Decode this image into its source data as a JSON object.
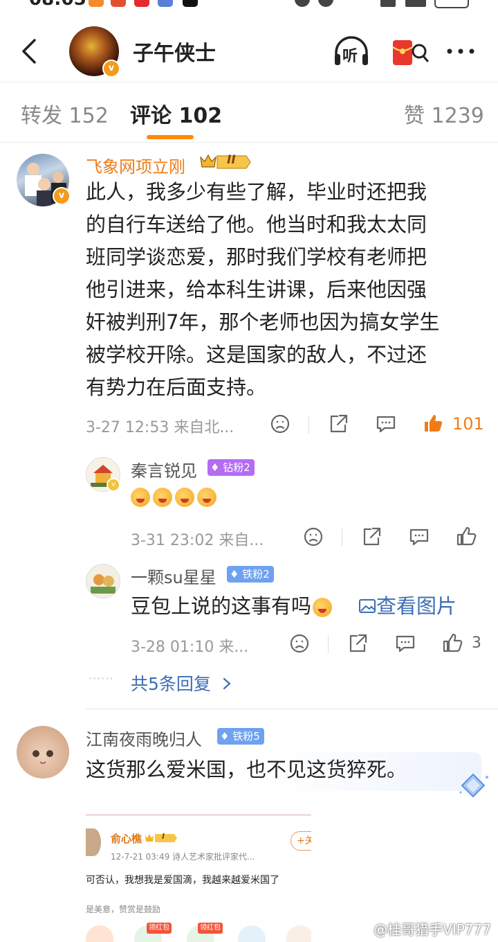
{
  "status_bar": {
    "time": "08:05"
  },
  "header": {
    "title": "子午侠士",
    "listen_label": "听"
  },
  "tabs": [
    {
      "label": "转发 152"
    },
    {
      "label": "评论 102"
    },
    {
      "label": "赞 1239"
    }
  ],
  "comments": [
    {
      "user": "飞象网项立刚",
      "level_badge": "II",
      "text": "此人，我多少有些了解，毕业时还把我的自行车送给了他。他当时和我太太同班同学谈恋爱，那时我们学校有老师把他引进来，给本科生讲课，后来他因强奸被判刑7年，那个老师也因为搞女学生被学校开除。这是国家的敌人，不过还有势力在后面支持。",
      "lines": [
        "此人，我多少有些了解，毕业时还把我",
        "的自行车送给了他。他当时和我太太同",
        "班同学谈恋爱，那时我们学校有老师把",
        "他引进来，给本科生讲课，后来他因强",
        "奸被判刑7年，那个老师也因为搞女学生",
        "被学校开除。这是国家的敌人，不过还",
        "有势力在后面支持。"
      ],
      "meta": "3-27 12:53  来自北...",
      "likes": "101",
      "replies": [
        {
          "user": "秦言锐见",
          "badge": "钻粉2",
          "meta": "3-31 23:02  来自...",
          "likes": ""
        },
        {
          "user": "一颗su星星",
          "badge": "铁粉2",
          "text": "豆包上说的这事有吗",
          "view_image": "查看图片",
          "meta": "3-28 01:10  来...",
          "likes": "3"
        }
      ],
      "more_replies": "共5条回复",
      "more_dots": "······"
    },
    {
      "user": "江南夜雨晚归人",
      "badge": "铁粉5",
      "text": "这货那么爱米国，也不见这货猝死。"
    }
  ],
  "embedded_screenshot": {
    "user": "俞心樵",
    "badge": "I",
    "meta": "12-7-21 03:49   诗人艺术家批评家代...",
    "follow": "+关",
    "line1": "可否认，我想我是爱国滴，我越来越爱米国了",
    "line2": "是美意，赞赏是鼓励",
    "tag1": "领红包",
    "tag2": "领红包"
  },
  "watermark": "@桂哥猎手VIP777",
  "colors": {
    "accent": "#ff8a00",
    "name_orange": "#f07c17",
    "link_blue": "#3b6db5",
    "like_orange": "#f07c17"
  }
}
